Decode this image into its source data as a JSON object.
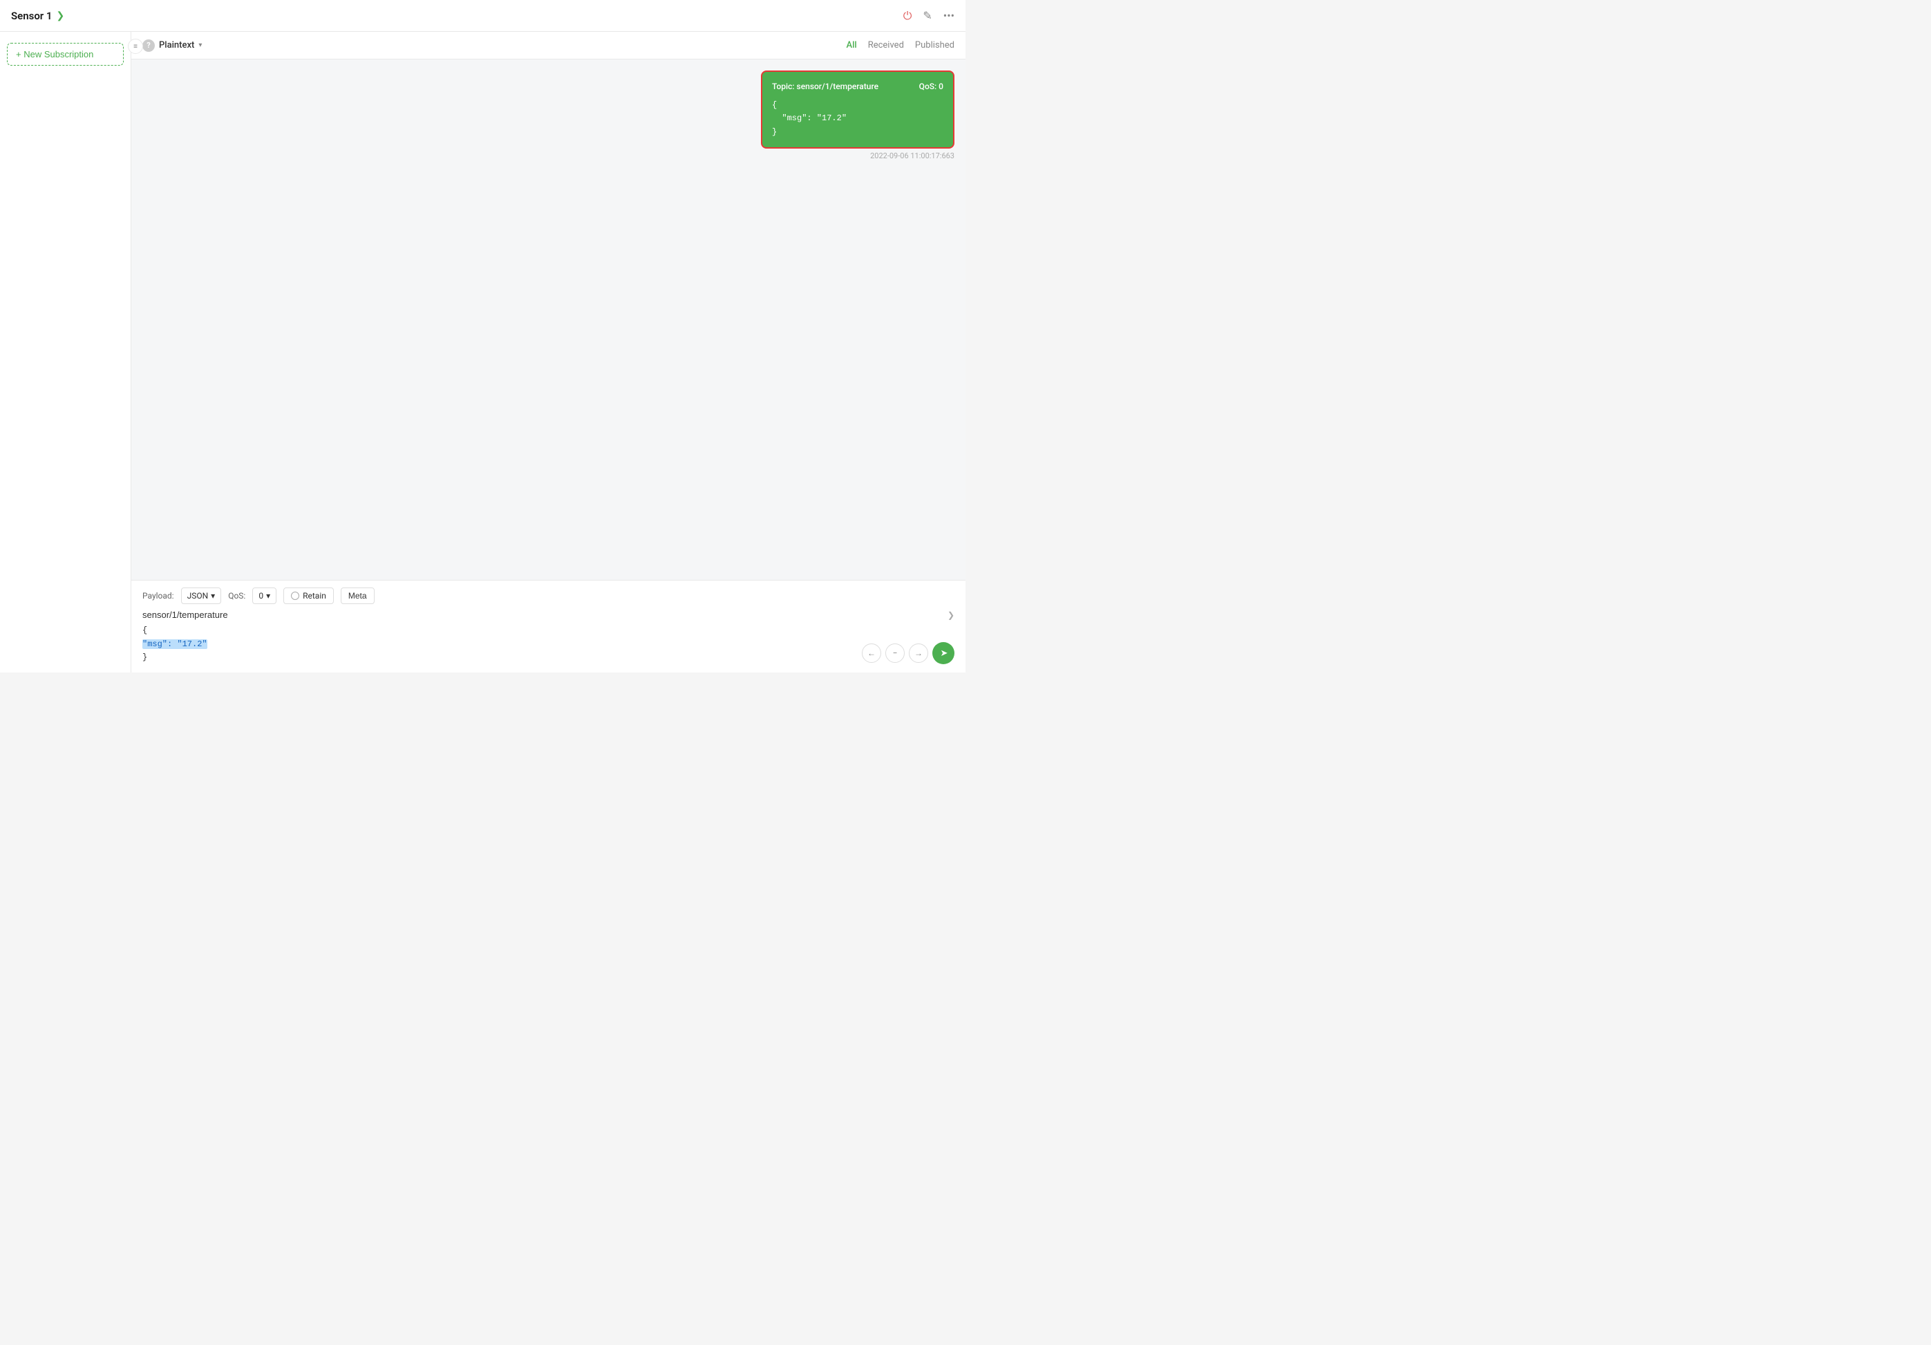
{
  "header": {
    "title": "Sensor 1",
    "chevron": "❯",
    "icons": {
      "power": "⏻",
      "edit": "✎",
      "more": "•••"
    }
  },
  "sidebar": {
    "new_subscription_label": "+ New Subscription"
  },
  "message_toolbar": {
    "help_icon": "?",
    "format_label": "Plaintext",
    "format_arrow": "▾",
    "filters": [
      "All",
      "Received",
      "Published"
    ],
    "active_filter": "All"
  },
  "message": {
    "topic": "sensor/1/temperature",
    "qos_label": "QoS:",
    "qos_value": "0",
    "body": "{\n  \"msg\": \"17.2\"\n}",
    "timestamp": "2022-09-06 11:00:17:663"
  },
  "bottom_panel": {
    "payload_label": "Payload:",
    "format_value": "JSON",
    "format_arrow": "▾",
    "qos_label": "QoS:",
    "qos_value": "0",
    "qos_arrow": "▾",
    "retain_label": "Retain",
    "meta_label": "Meta",
    "topic_value": "sensor/1/temperature",
    "topic_chevron": "❯",
    "payload_line1": "{",
    "payload_line2": "  \"msg\": \"17.2\"",
    "payload_line3": "}",
    "nav_prev": "←",
    "nav_minus": "−",
    "nav_next": "→",
    "send_icon": "➤"
  },
  "colors": {
    "green": "#4caf50",
    "red_border": "#e53935",
    "accent": "#4caf50"
  }
}
